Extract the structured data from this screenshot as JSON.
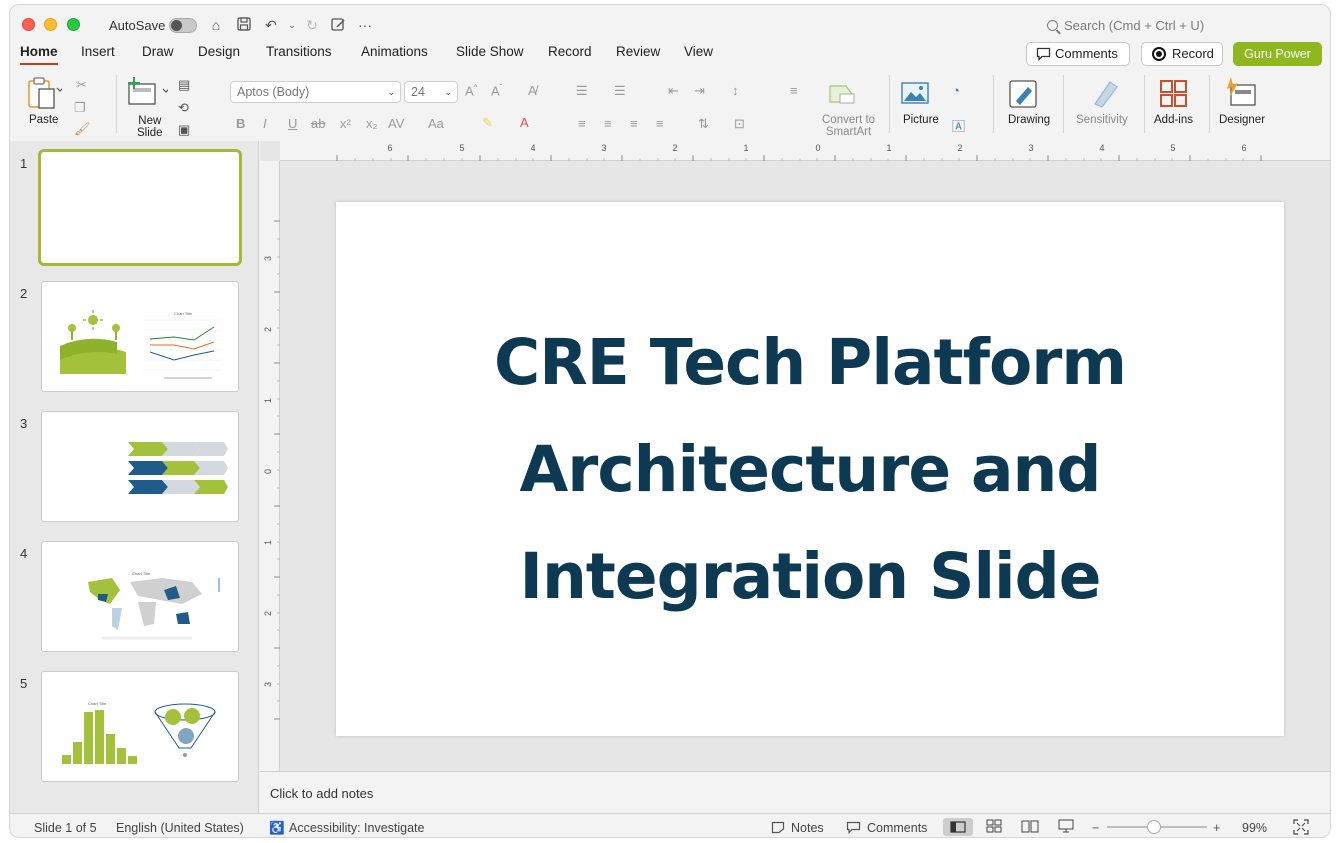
{
  "titlebar": {
    "autosave_label": "AutoSave",
    "search_placeholder": "Search (Cmd + Ctrl + U)"
  },
  "tabs": [
    "Home",
    "Insert",
    "Draw",
    "Design",
    "Transitions",
    "Animations",
    "Slide Show",
    "Record",
    "Review",
    "View"
  ],
  "active_tab": "Home",
  "top_buttons": {
    "comments": "Comments",
    "record": "Record",
    "guru": "Guru Power"
  },
  "ribbon": {
    "paste": "Paste",
    "new_slide_1": "New",
    "new_slide_2": "Slide",
    "font_name": "Aptos (Body)",
    "font_size": "24",
    "convert_1": "Convert to",
    "convert_2": "SmartArt",
    "picture": "Picture",
    "drawing": "Drawing",
    "sensitivity": "Sensitivity",
    "addins": "Add-ins",
    "designer": "Designer"
  },
  "slides": [
    {
      "num": "1"
    },
    {
      "num": "2"
    },
    {
      "num": "3"
    },
    {
      "num": "4"
    },
    {
      "num": "5"
    }
  ],
  "slide": {
    "title_line1": "CRE Tech Platform",
    "title_line2": "Architecture and",
    "title_line3": "Integration Slide"
  },
  "notes_placeholder": "Click to add notes",
  "status": {
    "slide_info": "Slide 1 of 5",
    "language": "English (United States)",
    "accessibility": "Accessibility: Investigate",
    "notes": "Notes",
    "comments": "Comments",
    "zoom": "99%"
  },
  "colors": {
    "accent_green": "#8fb81f",
    "title_navy": "#0d3a52",
    "tab_underline": "#c43e1c"
  }
}
